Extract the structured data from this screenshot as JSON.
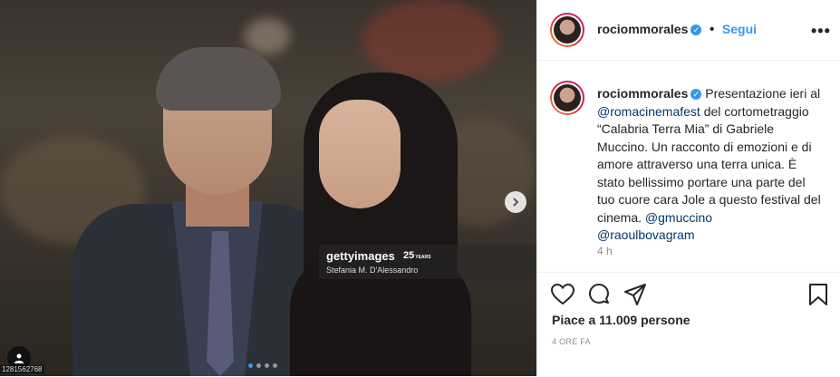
{
  "media": {
    "getty_logo": "gettyimages",
    "getty_badge": "25",
    "getty_badge_sub": "YEARS",
    "photo_credit": "Stefania M. D'Alessandro",
    "image_id": "1281562768",
    "carousel": {
      "count": 4,
      "active_index": 0
    },
    "next_icon": "chevron-right-icon",
    "user_tag_icon": "user-icon"
  },
  "header": {
    "username": "rociommorales",
    "separator": "•",
    "follow_label": "Segui",
    "more_icon": "ellipsis-icon",
    "more_label": "•••"
  },
  "caption": {
    "username": "rociommorales",
    "text_1": "Presentazione ieri al",
    "mention_1": "@romacinemafest",
    "text_2": "del cortometraggio “Calabria Terra Mia” di Gabriele Muccino. Un racconto di emozioni e di amore attraverso una terra unica. È stato bellissimo portare una parte del tuo cuore cara Jole a questo festival del cinema.",
    "mention_2": "@gmuccino",
    "mention_3": "@raoulbovagram",
    "time_ago": "4 h"
  },
  "actions": {
    "like_icon": "heart-icon",
    "comment_icon": "comment-icon",
    "share_icon": "share-icon",
    "save_icon": "bookmark-icon",
    "likes_text": "Piace a 11.009 persone",
    "date": "4 ORE FA"
  },
  "colors": {
    "accent": "#3897f0",
    "mention": "#00376b",
    "muted": "#8e8e8e"
  }
}
